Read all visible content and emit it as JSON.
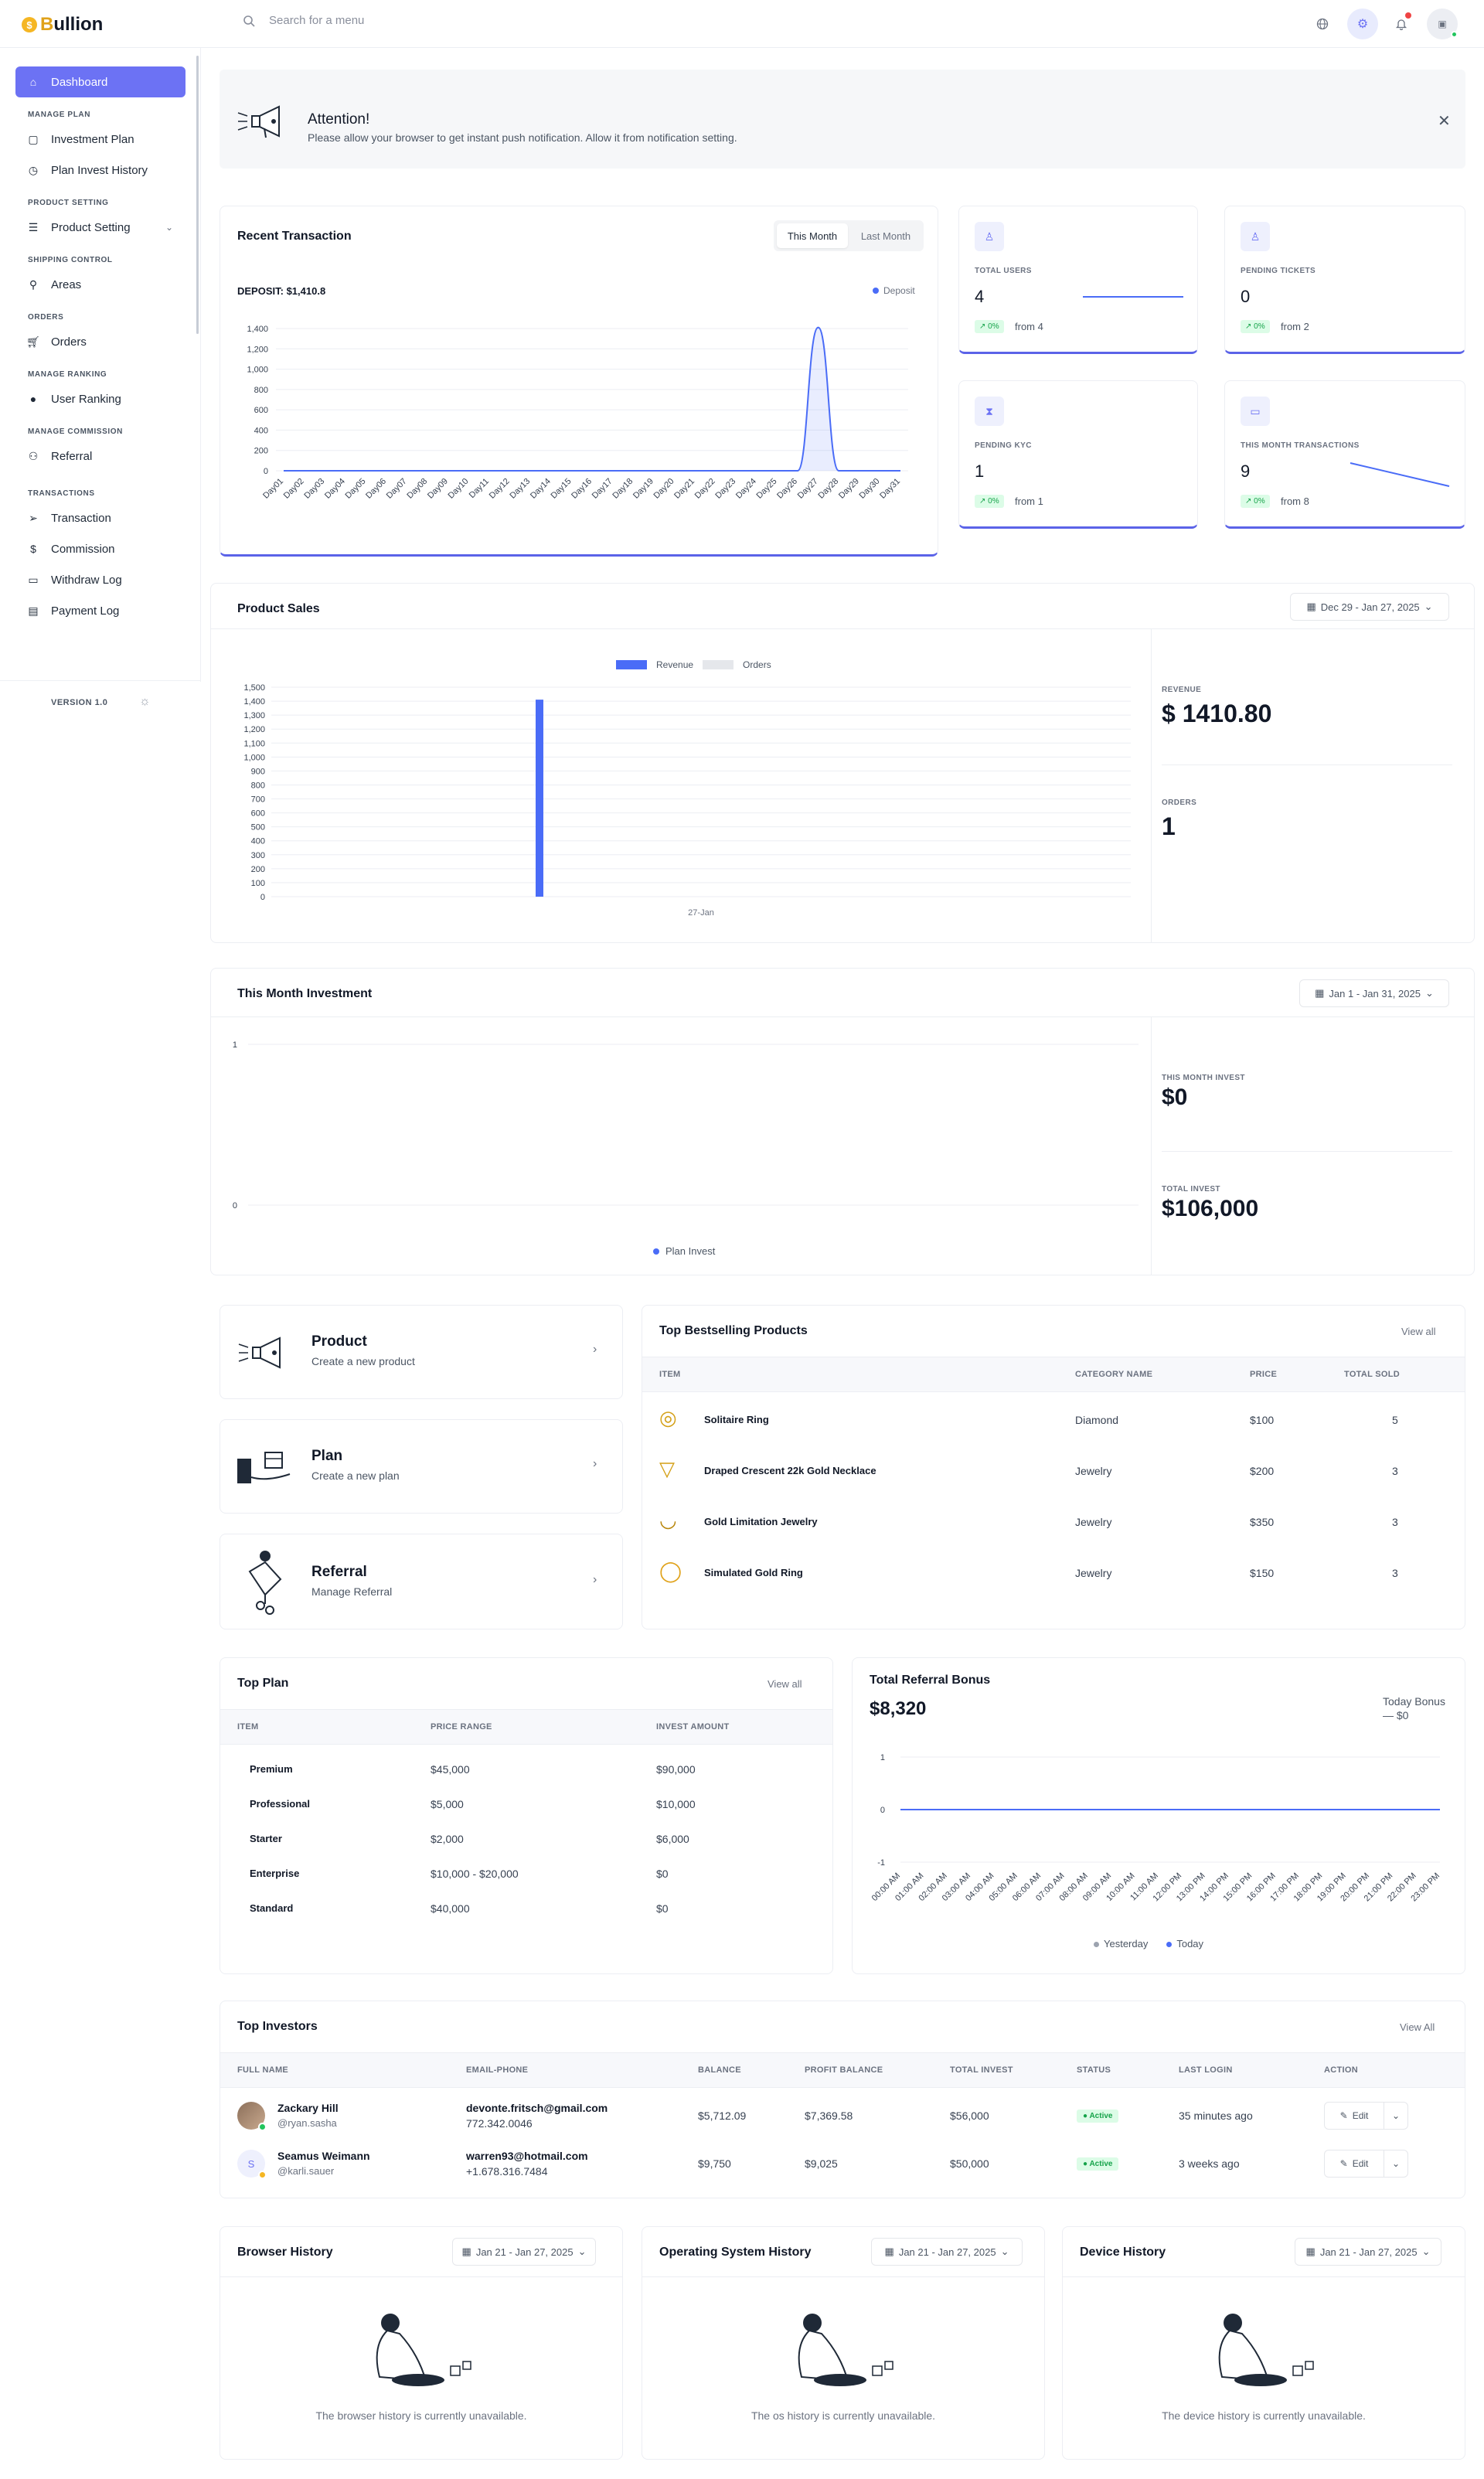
{
  "brand": {
    "prefix": "B",
    "name": "ullion"
  },
  "search": {
    "placeholder": "Search for a menu"
  },
  "sidebar": {
    "dashboard": "Dashboard",
    "sections": [
      {
        "title": "MANAGE PLAN",
        "items": [
          "Investment Plan",
          "Plan Invest History"
        ]
      },
      {
        "title": "PRODUCT SETTING",
        "items": [
          "Product Setting"
        ]
      },
      {
        "title": "SHIPPING CONTROL",
        "items": [
          "Areas"
        ]
      },
      {
        "title": "ORDERS",
        "items": [
          "Orders"
        ]
      },
      {
        "title": "MANAGE RANKING",
        "items": [
          "User Ranking"
        ]
      },
      {
        "title": "MANAGE COMMISSION",
        "items": [
          "Referral"
        ]
      },
      {
        "title": "TRANSACTIONS",
        "items": [
          "Transaction",
          "Commission",
          "Withdraw Log",
          "Payment Log"
        ]
      }
    ],
    "version": "VERSION 1.0"
  },
  "alert": {
    "title": "Attention!",
    "message": "Please allow your browser to get instant push notification. Allow it from notification setting."
  },
  "recent_transaction": {
    "title": "Recent Transaction",
    "tab_this": "This Month",
    "tab_last": "Last Month",
    "deposit_label": "DEPOSIT: $1,410.8",
    "legend": "Deposit"
  },
  "stats": [
    {
      "label": "TOTAL USERS",
      "value": "4",
      "badge": "0%",
      "from": "from 4"
    },
    {
      "label": "PENDING TICKETS",
      "value": "0",
      "badge": "0%",
      "from": "from 2"
    },
    {
      "label": "PENDING KYC",
      "value": "1",
      "badge": "0%",
      "from": "from 1"
    },
    {
      "label": "THIS MONTH TRANSACTIONS",
      "value": "9",
      "badge": "0%",
      "from": "from 8"
    }
  ],
  "product_sales": {
    "title": "Product Sales",
    "range": "Dec 29 - Jan 27, 2025",
    "legend_rev": "Revenue",
    "legend_orders": "Orders",
    "revenue_label": "REVENUE",
    "revenue": "$ 1410.80",
    "orders_label": "ORDERS",
    "orders": "1"
  },
  "investment": {
    "title": "This Month Investment",
    "range": "Jan 1 - Jan 31, 2025",
    "legend": "Plan Invest",
    "month_label": "THIS MONTH INVEST",
    "month": "$0",
    "total_label": "TOTAL INVEST",
    "total": "$106,000"
  },
  "quick_links": [
    {
      "title": "Product",
      "sub": "Create a new product"
    },
    {
      "title": "Plan",
      "sub": "Create a new plan"
    },
    {
      "title": "Referral",
      "sub": "Manage Referral"
    }
  ],
  "bestselling": {
    "title": "Top Bestselling Products",
    "view_all": "View all",
    "headers": [
      "ITEM",
      "CATEGORY NAME",
      "PRICE",
      "TOTAL SOLD"
    ],
    "rows": [
      {
        "name": "Solitaire Ring",
        "cat": "Diamond",
        "price": "$100",
        "sold": "5"
      },
      {
        "name": "Draped Crescent 22k Gold Necklace",
        "cat": "Jewelry",
        "price": "$200",
        "sold": "3"
      },
      {
        "name": "Gold Limitation Jewelry",
        "cat": "Jewelry",
        "price": "$350",
        "sold": "3"
      },
      {
        "name": "Simulated Gold Ring",
        "cat": "Jewelry",
        "price": "$150",
        "sold": "3"
      }
    ]
  },
  "top_plan": {
    "title": "Top Plan",
    "view_all": "View all",
    "headers": [
      "ITEM",
      "PRICE RANGE",
      "INVEST AMOUNT"
    ],
    "rows": [
      {
        "name": "Premium",
        "range": "$45,000",
        "amount": "$90,000"
      },
      {
        "name": "Professional",
        "range": "$5,000",
        "amount": "$10,000"
      },
      {
        "name": "Starter",
        "range": "$2,000",
        "amount": "$6,000"
      },
      {
        "name": "Enterprise",
        "range": "$10,000 - $20,000",
        "amount": "$0"
      },
      {
        "name": "Standard",
        "range": "$40,000",
        "amount": "$0"
      }
    ]
  },
  "referral_bonus": {
    "title": "Total Referral Bonus",
    "total": "$8,320",
    "today_label": "Today Bonus",
    "today": "— $0",
    "legend_y": "Yesterday",
    "legend_t": "Today"
  },
  "investors": {
    "title": "Top Investors",
    "view_all": "View All",
    "headers": [
      "FULL NAME",
      "EMAIL-PHONE",
      "BALANCE",
      "PROFIT BALANCE",
      "TOTAL INVEST",
      "STATUS",
      "LAST LOGIN",
      "ACTION"
    ],
    "rows": [
      {
        "name": "Zackary Hill",
        "user": "@ryan.sasha",
        "email": "devonte.fritsch@gmail.com",
        "phone": "772.342.0046",
        "balance": "$5,712.09",
        "profit": "$7,369.58",
        "invest": "$56,000",
        "status": "Active",
        "login": "35 minutes ago",
        "action": "Edit",
        "initial": ""
      },
      {
        "name": "Seamus Weimann",
        "user": "@karli.sauer",
        "email": "warren93@hotmail.com",
        "phone": "+1.678.316.7484",
        "balance": "$9,750",
        "profit": "$9,025",
        "invest": "$50,000",
        "status": "Active",
        "login": "3 weeks ago",
        "action": "Edit",
        "initial": "S"
      }
    ]
  },
  "history": [
    {
      "title": "Browser History",
      "range": "Jan 21 - Jan 27, 2025",
      "empty": "The browser history is currently unavailable."
    },
    {
      "title": "Operating System History",
      "range": "Jan 21 - Jan 27, 2025",
      "empty": "The os history is currently unavailable."
    },
    {
      "title": "Device History",
      "range": "Jan 21 - Jan 27, 2025",
      "empty": "The device history is currently unavailable."
    }
  ],
  "chart_data": [
    {
      "type": "area",
      "title": "Recent Transaction",
      "series": [
        {
          "name": "Deposit",
          "values": [
            0,
            0,
            0,
            0,
            0,
            0,
            0,
            0,
            0,
            0,
            0,
            0,
            0,
            0,
            0,
            0,
            0,
            0,
            0,
            0,
            0,
            0,
            0,
            0,
            0,
            0,
            1410.8,
            0,
            0,
            0,
            0
          ]
        }
      ],
      "categories": [
        "Day01",
        "Day02",
        "Day03",
        "Day04",
        "Day05",
        "Day06",
        "Day07",
        "Day08",
        "Day09",
        "Day10",
        "Day11",
        "Day12",
        "Day13",
        "Day14",
        "Day15",
        "Day16",
        "Day17",
        "Day18",
        "Day19",
        "Day20",
        "Day21",
        "Day22",
        "Day23",
        "Day24",
        "Day25",
        "Day26",
        "Day27",
        "Day28",
        "Day29",
        "Day30",
        "Day31"
      ],
      "yticks": [
        0,
        200,
        400,
        600,
        800,
        1000,
        1200,
        1400
      ],
      "ylim": [
        0,
        1400
      ]
    },
    {
      "type": "bar",
      "title": "Product Sales",
      "categories": [
        "27-Jan"
      ],
      "series": [
        {
          "name": "Revenue",
          "values": [
            1410.8
          ]
        },
        {
          "name": "Orders",
          "values": [
            1
          ]
        }
      ],
      "yticks": [
        0,
        100,
        200,
        300,
        400,
        500,
        600,
        700,
        800,
        900,
        1000,
        1100,
        1200,
        1300,
        1400,
        1500
      ],
      "ylim": [
        0,
        1500
      ]
    },
    {
      "type": "line",
      "title": "This Month Investment",
      "series": [
        {
          "name": "Plan Invest",
          "values": []
        }
      ],
      "yticks": [
        0,
        1
      ],
      "ylim": [
        0,
        1
      ]
    },
    {
      "type": "line",
      "title": "Total Referral Bonus",
      "categories": [
        "00:00 AM",
        "01:00 AM",
        "02:00 AM",
        "03:00 AM",
        "04:00 AM",
        "05:00 AM",
        "06:00 AM",
        "07:00 AM",
        "08:00 AM",
        "09:00 AM",
        "10:00 AM",
        "11:00 AM",
        "12:00 PM",
        "13:00 PM",
        "14:00 PM",
        "15:00 PM",
        "16:00 PM",
        "17:00 PM",
        "18:00 PM",
        "19:00 PM",
        "20:00 PM",
        "21:00 PM",
        "22:00 PM",
        "23:00 PM"
      ],
      "series": [
        {
          "name": "Yesterday",
          "values": [
            0,
            0,
            0,
            0,
            0,
            0,
            0,
            0,
            0,
            0,
            0,
            0,
            0,
            0,
            0,
            0,
            0,
            0,
            0,
            0,
            0,
            0,
            0,
            0
          ]
        },
        {
          "name": "Today",
          "values": [
            0,
            0,
            0,
            0,
            0,
            0,
            0,
            0,
            0,
            0,
            0,
            0,
            0,
            0,
            0,
            0,
            0,
            0,
            0,
            0,
            0,
            0,
            0,
            0
          ]
        }
      ],
      "yticks": [
        -1,
        0,
        1
      ],
      "ylim": [
        -1,
        1
      ]
    }
  ],
  "colors": {
    "accent": "#6c72f4",
    "chart_blue": "#4a6cf7",
    "success": "#16a34a"
  }
}
